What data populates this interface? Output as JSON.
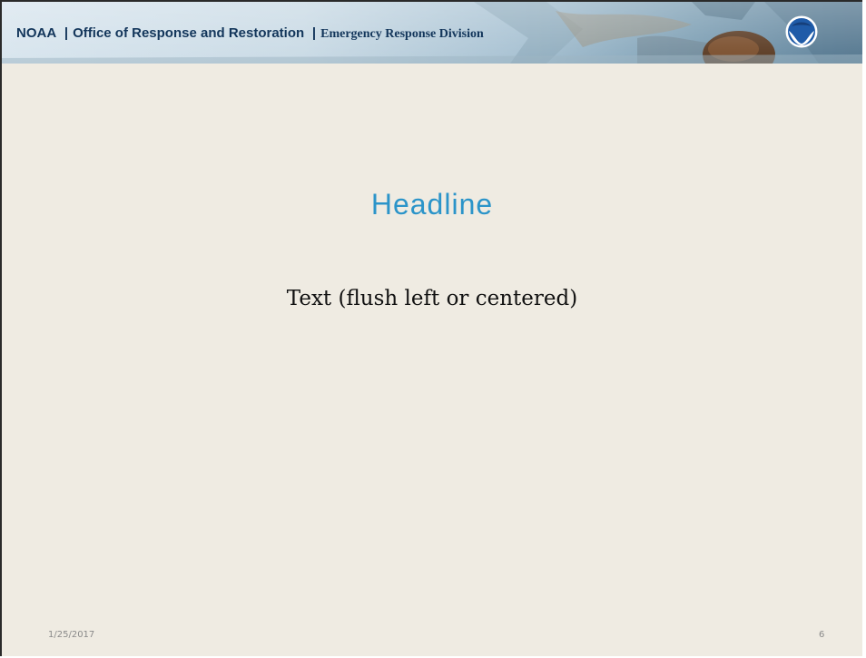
{
  "banner": {
    "org": "NOAA",
    "separator": "|",
    "office": "Office of Response and Restoration",
    "division": "Emergency Response Division",
    "logo_icon": "noaa-seal-icon",
    "colors": {
      "text": "#13365b",
      "logo_blue": "#1f5ba8"
    }
  },
  "slide": {
    "headline": "Headline",
    "body": "Text (flush left or centered)",
    "date": "1/25/2017",
    "page_number": "6",
    "colors": {
      "background": "#efebe2",
      "headline": "#2b94c9",
      "body": "#111111",
      "footer": "#8a8a8a"
    }
  }
}
